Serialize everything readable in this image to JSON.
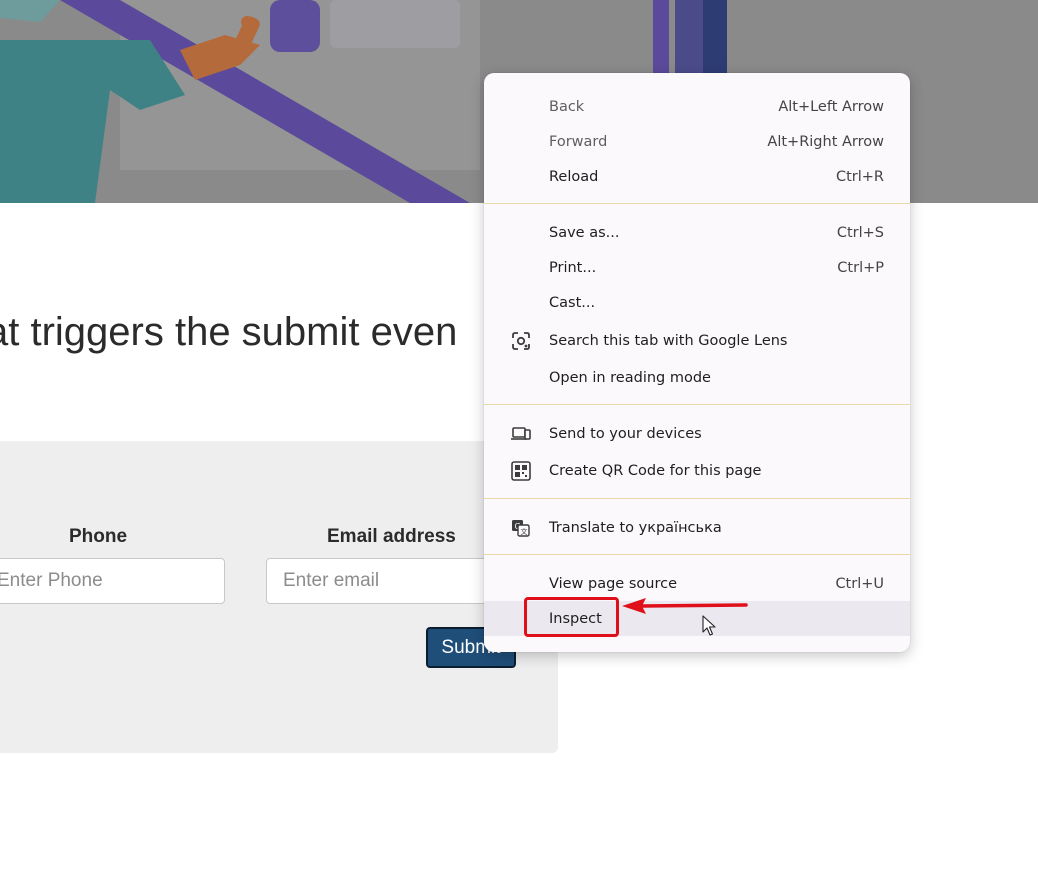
{
  "page": {
    "heading": "at triggers the submit even",
    "form": {
      "phone_label": "Phone",
      "phone_placeholder": "Enter Phone",
      "email_label": "Email address",
      "email_placeholder": "Enter email",
      "submit_label": "Submit"
    }
  },
  "context_menu": {
    "groups": [
      [
        {
          "label": "Back",
          "shortcut": "Alt+Left Arrow",
          "disabled": true
        },
        {
          "label": "Forward",
          "shortcut": "Alt+Right Arrow",
          "disabled": true
        },
        {
          "label": "Reload",
          "shortcut": "Ctrl+R"
        }
      ],
      [
        {
          "label": "Save as...",
          "shortcut": "Ctrl+S"
        },
        {
          "label": "Print...",
          "shortcut": "Ctrl+P"
        },
        {
          "label": "Cast..."
        },
        {
          "label": "Search this tab with Google Lens",
          "icon": "google-lens-icon"
        },
        {
          "label": "Open in reading mode"
        }
      ],
      [
        {
          "label": "Send to your devices",
          "icon": "devices-icon"
        },
        {
          "label": "Create QR Code for this page",
          "icon": "qr-code-icon"
        }
      ],
      [
        {
          "label": "Translate to українська",
          "icon": "translate-icon"
        }
      ],
      [
        {
          "label": "View page source",
          "shortcut": "Ctrl+U"
        },
        {
          "label": "Inspect",
          "hovered": true,
          "highlighted": true
        }
      ]
    ]
  },
  "annotation": {
    "highlight_color": "#e0101a"
  },
  "colors": {
    "hero_overlay": "#8a8a8a",
    "submit_button": "#1f4e79",
    "menu_background": "#fbf9fc",
    "separator": "#ebd9a8"
  }
}
